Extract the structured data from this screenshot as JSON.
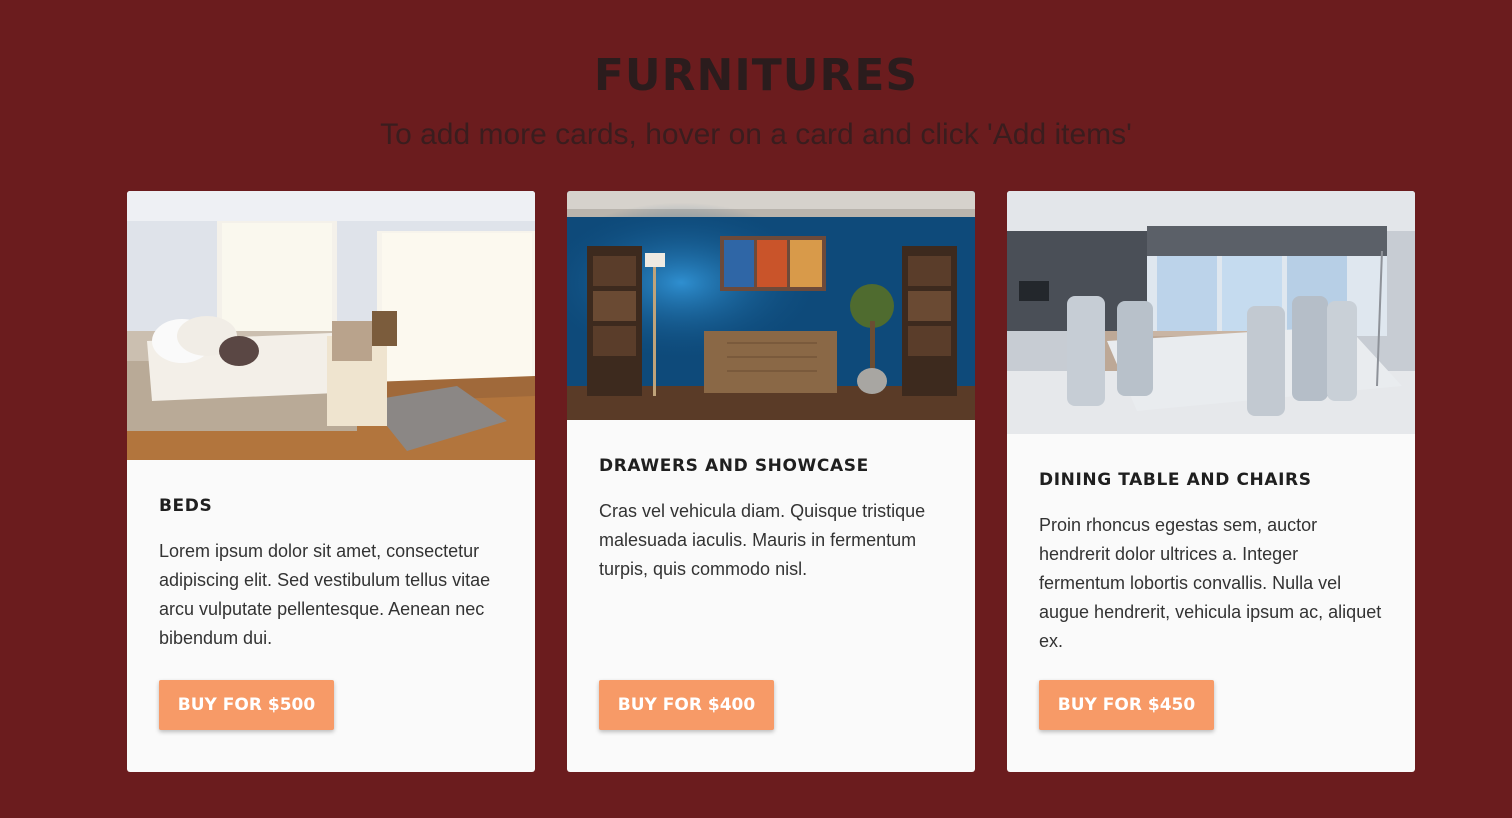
{
  "header": {
    "title": "FURNITURES",
    "subtitle": "To add more cards, hover on a card and click 'Add items'"
  },
  "cards": [
    {
      "title": "BEDS",
      "description": "Lorem ipsum dolor sit amet, consectetur adipiscing elit. Sed vestibulum tellus vitae arcu vulputate pellentesque. Aenean nec bibendum dui.",
      "button": "BUY FOR $500",
      "image_alt": "bedroom-photo"
    },
    {
      "title": "DRAWERS AND SHOWCASE",
      "description": "Cras vel vehicula diam. Quisque tristique malesuada iaculis. Mauris in fermentum turpis, quis commodo nisl.",
      "button": "BUY FOR $400",
      "image_alt": "living-room-drawers-photo"
    },
    {
      "title": "DINING TABLE AND CHAIRS",
      "description": "Proin rhoncus egestas sem, auctor hendrerit dolor ultrices a. Integer fermentum lobortis convallis. Nulla vel augue hendrerit, vehicula ipsum ac, aliquet ex.",
      "button": "BUY FOR $450",
      "image_alt": "dining-room-photo"
    }
  ],
  "colors": {
    "background": "#6b1c1e",
    "card": "#fafafa",
    "button": "#f79a67"
  }
}
